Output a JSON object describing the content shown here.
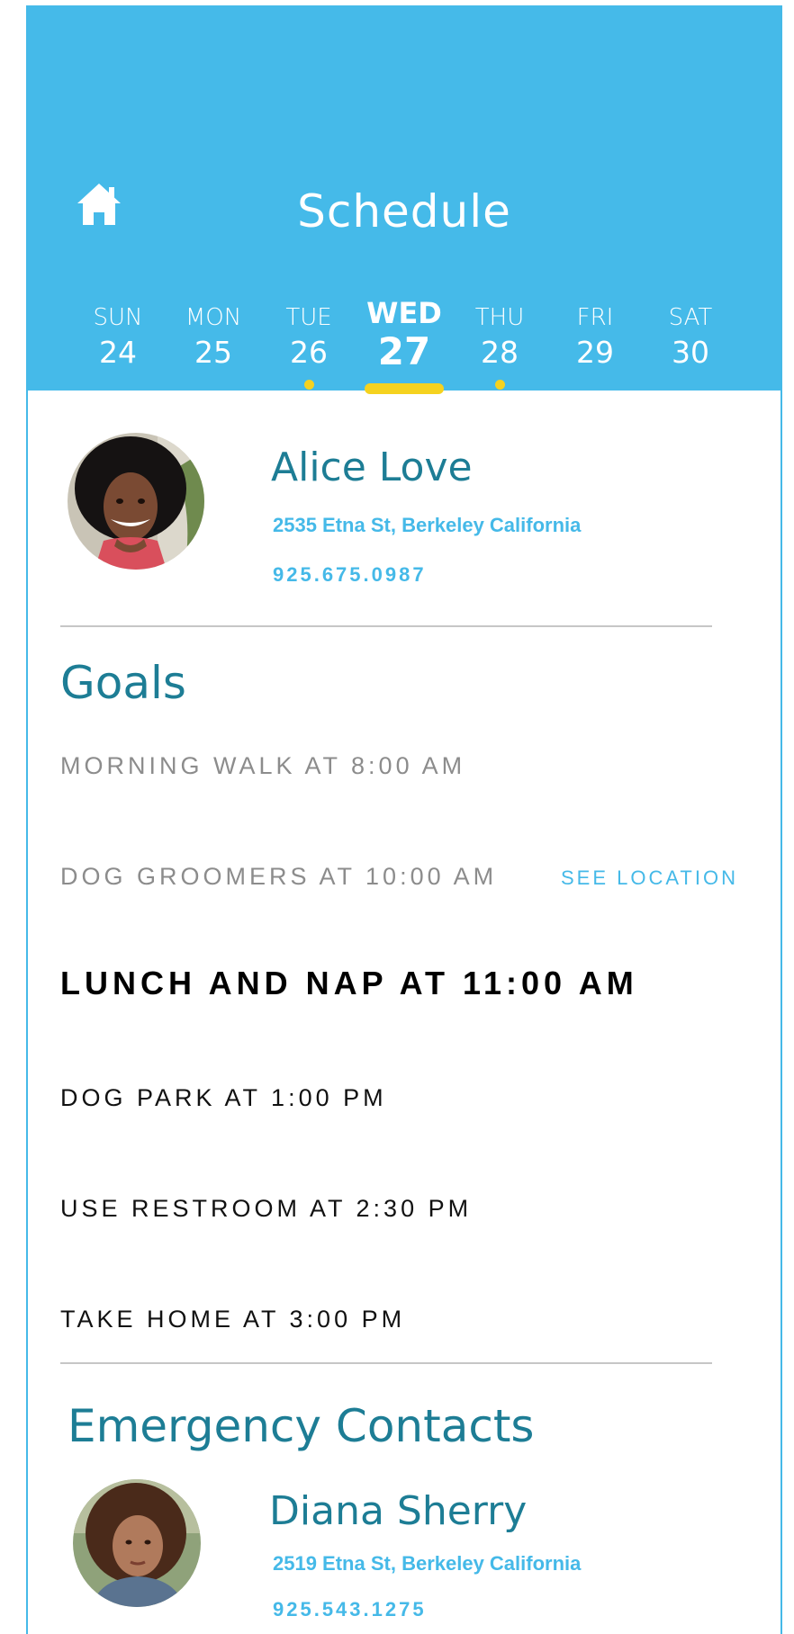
{
  "header": {
    "title": "Schedule",
    "home_icon": "home-icon",
    "colors": {
      "background": "#45bae9",
      "indicator": "#f5d21f"
    }
  },
  "days": [
    {
      "name": "SUN",
      "num": "24",
      "active": false,
      "has_event": false
    },
    {
      "name": "MON",
      "num": "25",
      "active": false,
      "has_event": false
    },
    {
      "name": "TUE",
      "num": "26",
      "active": false,
      "has_event": true
    },
    {
      "name": "WED",
      "num": "27",
      "active": true,
      "has_event": false
    },
    {
      "name": "THU",
      "num": "28",
      "active": false,
      "has_event": true
    },
    {
      "name": "FRI",
      "num": "29",
      "active": false,
      "has_event": false
    },
    {
      "name": "SAT",
      "num": "30",
      "active": false,
      "has_event": false
    }
  ],
  "client": {
    "name": "Alice Love",
    "address": "2535 Etna St, Berkeley California",
    "phone": "925.675.0987"
  },
  "goals": {
    "title": "Goals",
    "items": [
      {
        "text": "MORNING WALK AT 8:00 AM",
        "state": "done"
      },
      {
        "text": "DOG GROOMERS AT 10:00 AM",
        "state": "done",
        "action": "SEE LOCATION"
      },
      {
        "text": "LUNCH AND NAP AT 11:00 AM",
        "state": "current"
      },
      {
        "text": "DOG PARK AT 1:00 PM",
        "state": "pending"
      },
      {
        "text": "USE RESTROOM AT 2:30 PM",
        "state": "pending"
      },
      {
        "text": "TAKE HOME AT 3:00 PM",
        "state": "pending"
      }
    ]
  },
  "emergency": {
    "title": "Emergency Contacts",
    "contact": {
      "name": "Diana Sherry",
      "address": "2519 Etna St, Berkeley California",
      "phone": "925.543.1275"
    }
  },
  "colors": {
    "accent": "#45b9e8",
    "heading": "#1d7d95",
    "done_text": "#8c8c8c"
  }
}
